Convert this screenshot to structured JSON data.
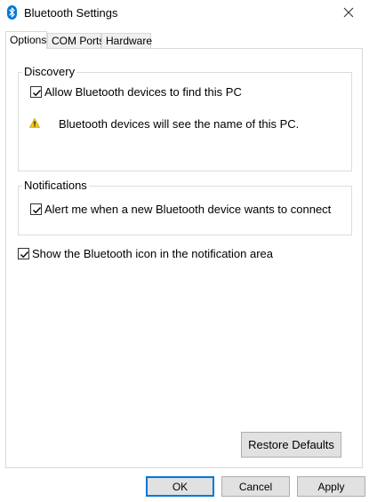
{
  "window": {
    "title": "Bluetooth Settings",
    "title_icon": "bluetooth-icon",
    "close_icon": "close-icon"
  },
  "tabs": [
    {
      "label": "Options",
      "active": true
    },
    {
      "label": "COM Ports",
      "active": false
    },
    {
      "label": "Hardware",
      "active": false
    }
  ],
  "discovery": {
    "legend": "Discovery",
    "allow_label": "Allow Bluetooth devices to find this PC",
    "allow_checked": true,
    "warning_icon": "warning-icon",
    "warning_text": "Bluetooth devices will see the name of this PC."
  },
  "notifications": {
    "legend": "Notifications",
    "alert_label": "Alert me when a new Bluetooth device wants to connect",
    "alert_checked": true
  },
  "show_icon": {
    "label": "Show the Bluetooth icon in the notification area",
    "checked": true
  },
  "buttons": {
    "restore": "Restore Defaults",
    "ok": "OK",
    "cancel": "Cancel",
    "apply": "Apply"
  },
  "colors": {
    "accent": "#0078d7",
    "button_face": "#e1e1e1",
    "warning": "#f2c811"
  }
}
